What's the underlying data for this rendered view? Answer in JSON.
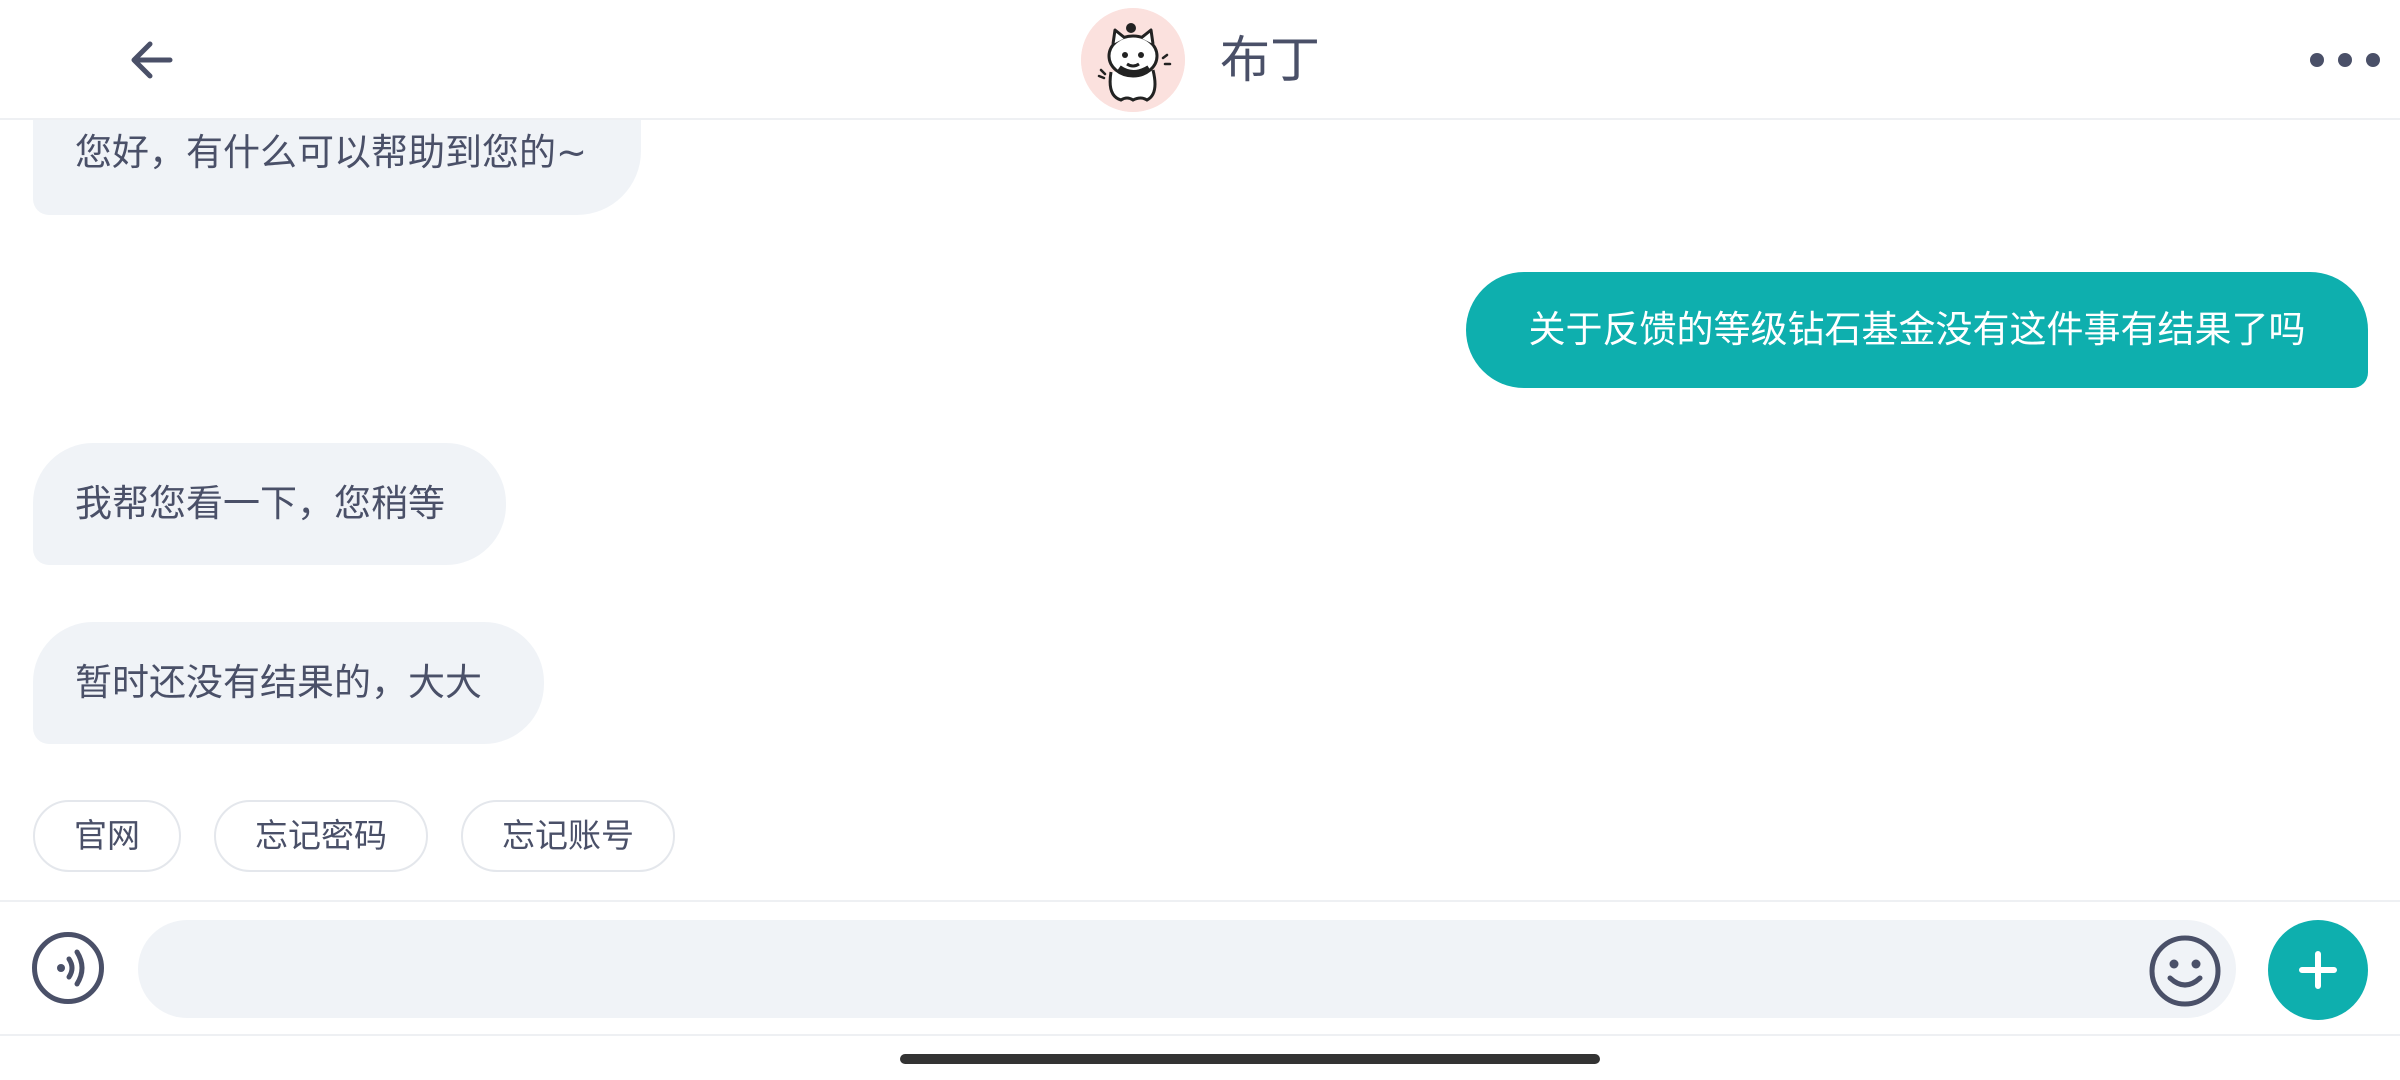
{
  "header": {
    "title": "布丁",
    "back_icon": "arrow-left-icon",
    "more_icon": "more-dots-icon",
    "avatar_icon": "cartoon-cat-avatar"
  },
  "messages": [
    {
      "side": "incoming",
      "text": "您好，有什么可以帮助到您的~"
    },
    {
      "side": "outgoing",
      "text": "关于反馈的等级钻石基金没有这件事有结果了吗"
    },
    {
      "side": "incoming",
      "text": "我帮您看一下，您稍等"
    },
    {
      "side": "incoming",
      "text": "暂时还没有结果的，大大"
    }
  ],
  "quick_replies": [
    "官网",
    "忘记密码",
    "忘记账号"
  ],
  "input": {
    "value": "",
    "placeholder": "",
    "voice_icon": "voice-icon",
    "emoji_icon": "emoji-icon",
    "add_icon": "plus-icon"
  },
  "colors": {
    "accent": "#0eafae",
    "text": "#4a5068",
    "bubble_bg": "#f0f3f7"
  }
}
